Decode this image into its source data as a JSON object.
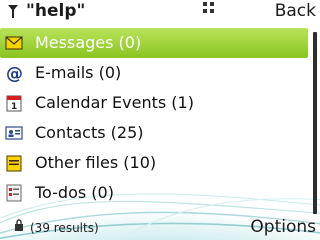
{
  "header": {
    "search_query": "\"help\"",
    "back_label": "Back"
  },
  "results": {
    "items": [
      {
        "label": "Messages (0)",
        "icon": "envelope-icon",
        "selected": true
      },
      {
        "label": "E-mails (0)",
        "icon": "at-sign-icon",
        "selected": false
      },
      {
        "label": "Calendar Events (1)",
        "icon": "calendar-icon",
        "selected": false
      },
      {
        "label": "Contacts (25)",
        "icon": "contact-card-icon",
        "selected": false
      },
      {
        "label": "Other files (10)",
        "icon": "file-icon",
        "selected": false
      },
      {
        "label": "To-dos (0)",
        "icon": "todo-list-icon",
        "selected": false
      }
    ]
  },
  "footer": {
    "results_count": "(39 results)",
    "options_label": "Options"
  },
  "colors": {
    "selection": "#9bd03a",
    "accent_teal": "#9fd6d8"
  }
}
